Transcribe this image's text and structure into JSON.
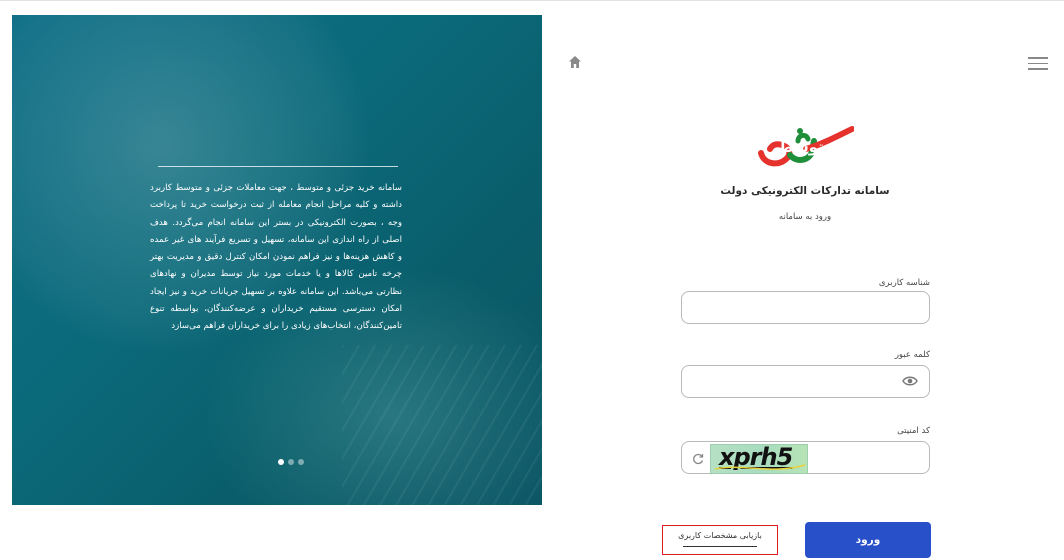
{
  "hero": {
    "title": "خرید جزئی و متوسط",
    "description": "سامانه خرید جزئی و متوسط ، جهت معاملات جزئی و متوسط کاربرد داشته و کلیه مراحل انجام معامله از ثبت درخواست خرید تا پرداخت وجه ، بصورت الکترونیکی در بستر این سامانه انجام می‌گردد. هدف اصلی از راه اندازی این سامانه، تسهیل و تسریع فرآیند های غیر عمده و کاهش هزینه‌ها و نیز فراهم نمودن امکان کنترل دقیق و مدیریت بهتر چرخه تامین کالاها و یا خدمات مورد نیاز توسط مدیران و نهادهای نظارتی می‌باشد. این سامانه علاوه بر تسهیل جریانات خرید و نیز ایجاد امکان دسترسی مستقیم خریداران و عرضه‌کنندگان، بواسطه تنوع تامین‌کنندگان، انتخاب‌های زیادی را برای خریداران فراهم می‌سازد",
    "slide_count": 3,
    "active_slide": 1
  },
  "header": {
    "home_icon": "home-icon",
    "menu_icon": "hamburger-menu-icon"
  },
  "brand": {
    "org_name": "سامانه تدارکات الکترونیکی دولت",
    "login_subtitle": "ورود به سامانه",
    "logo_color_red": "#e5322d",
    "logo_color_green": "#1f8f3a"
  },
  "form": {
    "username_label": "شناسه کاربری",
    "username_value": "",
    "password_label": "کلمه عبور",
    "password_value": "",
    "captcha_label": "کد امنیتی",
    "captcha_text": "xprh5",
    "captcha_value": "",
    "login_button": "ورود",
    "recover_link": "بازیابی مشخصات کاربری"
  },
  "colors": {
    "primary": "#2750c9",
    "highlight_box": "#d91c1c"
  }
}
